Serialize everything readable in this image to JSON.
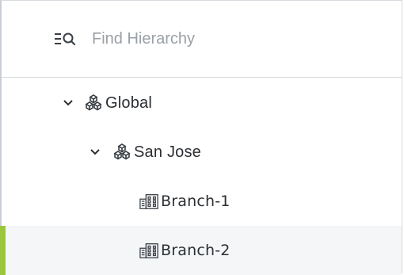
{
  "search": {
    "placeholder": "Find Hierarchy",
    "icon": "filter-search-icon"
  },
  "tree": {
    "nodes": [
      {
        "label": "Global",
        "icon": "area-icon",
        "expanded": true,
        "level": 0
      },
      {
        "label": "San Jose",
        "icon": "area-icon",
        "expanded": true,
        "level": 1
      },
      {
        "label": "Branch-1",
        "icon": "building-icon",
        "level": 2
      },
      {
        "label": "Branch-2",
        "icon": "building-icon",
        "level": 2,
        "selected": true
      }
    ]
  },
  "colors": {
    "selected_indicator": "#9bc53d",
    "selected_background": "#f4f6f8",
    "text": "#2b2f33",
    "placeholder": "#9aa0a6"
  }
}
